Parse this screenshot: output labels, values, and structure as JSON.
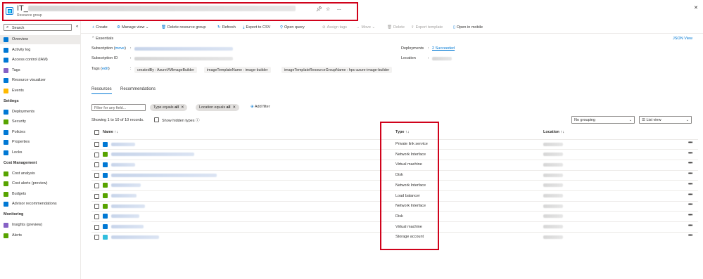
{
  "header": {
    "title": "IT_",
    "title_redacted": "hpc-azure-image-builder_image-builder_5f3c7bca_0b07_4bd4_a26a_d77b0b0b0b0b",
    "subtitle": "Resource group",
    "pin_icon": "pin-icon",
    "favorite_icon": "star-icon",
    "more_label": "..."
  },
  "close_label": "✕",
  "sidebar": {
    "search_placeholder": "Search",
    "collapse_label": "«",
    "items": [
      {
        "label": "Overview",
        "icon": "overview-icon",
        "color": "#0078d4",
        "active": true
      },
      {
        "label": "Activity log",
        "icon": "activity-log-icon",
        "color": "#0078d4"
      },
      {
        "label": "Access control (IAM)",
        "icon": "iam-icon",
        "color": "#0078d4"
      },
      {
        "label": "Tags",
        "icon": "tag-icon",
        "color": "#8661c5"
      },
      {
        "label": "Resource visualizer",
        "icon": "visualizer-icon",
        "color": "#0078d4"
      },
      {
        "label": "Events",
        "icon": "events-icon",
        "color": "#ffb900"
      }
    ],
    "sections": [
      {
        "title": "Settings",
        "items": [
          {
            "label": "Deployments",
            "icon": "deployments-icon",
            "color": "#0078d4"
          },
          {
            "label": "Security",
            "icon": "security-icon",
            "color": "#57a300"
          },
          {
            "label": "Policies",
            "icon": "policies-icon",
            "color": "#0078d4"
          },
          {
            "label": "Properties",
            "icon": "properties-icon",
            "color": "#0078d4"
          },
          {
            "label": "Locks",
            "icon": "lock-icon",
            "color": "#0078d4"
          }
        ]
      },
      {
        "title": "Cost Management",
        "items": [
          {
            "label": "Cost analysis",
            "icon": "cost-analysis-icon",
            "color": "#57a300"
          },
          {
            "label": "Cost alerts (preview)",
            "icon": "cost-alerts-icon",
            "color": "#57a300"
          },
          {
            "label": "Budgets",
            "icon": "budgets-icon",
            "color": "#57a300"
          },
          {
            "label": "Advisor recommendations",
            "icon": "advisor-icon",
            "color": "#0078d4"
          }
        ]
      },
      {
        "title": "Monitoring",
        "items": [
          {
            "label": "Insights (preview)",
            "icon": "insights-icon",
            "color": "#8661c5"
          },
          {
            "label": "Alerts",
            "icon": "alerts-icon",
            "color": "#57a300"
          }
        ]
      }
    ]
  },
  "toolbar": {
    "create": "Create",
    "manage_view": "Manage view",
    "delete_rg": "Delete resource group",
    "refresh": "Refresh",
    "export_csv": "Export to CSV",
    "open_query": "Open query",
    "assign_tags": "Assign tags",
    "move": "Move",
    "delete": "Delete",
    "export_template": "Export template",
    "open_mobile": "Open in mobile"
  },
  "essentials": {
    "toggle_label": "Essentials",
    "json_view": "JSON View",
    "subscription_label": "Subscription",
    "subscription_move": "move",
    "subscription_id_label": "Subscription ID",
    "tags_label": "Tags",
    "tags_edit": "edit",
    "deployments_label": "Deployments",
    "deployments_value": "2 Succeeded",
    "location_label": "Location",
    "tags": [
      "createdBy : AzureVMImageBuilder",
      "imageTemplateName : image-builder",
      "imageTemplateResourceGroupName : hpc-azure-image-builder"
    ]
  },
  "tabs": {
    "resources": "Resources",
    "recommendations": "Recommendations"
  },
  "filters": {
    "placeholder": "Filter for any field...",
    "type_filter_prefix": "Type equals",
    "type_filter_value": "all",
    "location_filter_prefix": "Location equals",
    "location_filter_value": "all",
    "add_filter": "Add filter",
    "count_text": "Showing 1 to 10 of 10 records.",
    "show_hidden": "Show hidden types",
    "grouping": "No grouping",
    "view": "List view"
  },
  "table": {
    "columns": {
      "name": "Name",
      "type": "Type",
      "location": "Location"
    },
    "sort_icon": "↑↓",
    "more_label": "•••",
    "rows": [
      {
        "type": "Private link service",
        "icon_color": "#0078d4"
      },
      {
        "type": "Network Interface",
        "icon_color": "#57a300"
      },
      {
        "type": "Virtual machine",
        "icon_color": "#0078d4"
      },
      {
        "type": "Disk",
        "icon_color": "#0078d4"
      },
      {
        "type": "Network Interface",
        "icon_color": "#57a300"
      },
      {
        "type": "Load balancer",
        "icon_color": "#57a300"
      },
      {
        "type": "Network Interface",
        "icon_color": "#57a300"
      },
      {
        "type": "Disk",
        "icon_color": "#0078d4"
      },
      {
        "type": "Virtual machine",
        "icon_color": "#0078d4"
      },
      {
        "type": "Storage account",
        "icon_color": "#32bedd"
      }
    ]
  }
}
